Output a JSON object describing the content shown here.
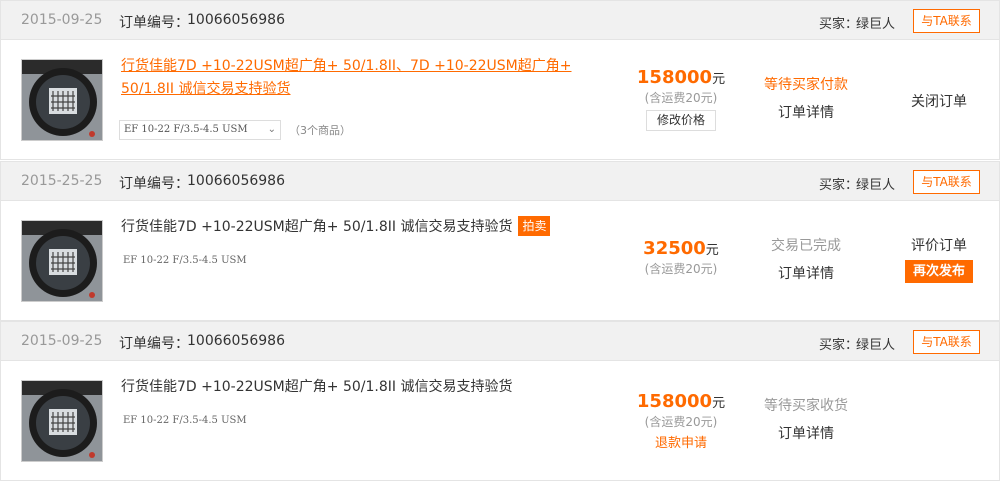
{
  "orders": [
    {
      "date": "2015-09-25",
      "order_no_label": "订单编号：",
      "order_no": "10066056986",
      "buyer_label": "买家：",
      "buyer_name": "绿巨人",
      "contact_label": "与TA联系",
      "title": "行货佳能7D +10-22USM超广角+ 50/1.8II、7D +10-22USM超广角+ 50/1.8II 诚信交易支持验货",
      "spec_select": "EF 10-22 F/3.5-4.5 USM",
      "item_count": "（3个商品）",
      "price": "158000",
      "price_unit": "元",
      "shipping": "(含运费20元)",
      "modify_price_label": "修改价格",
      "status": "等待买家付款",
      "detail_label": "订单详情",
      "action_label": "关闭订单"
    },
    {
      "date": "2015-25-25",
      "order_no_label": "订单编号：",
      "order_no": "10066056986",
      "buyer_label": "买家：",
      "buyer_name": "绿巨人",
      "contact_label": "与TA联系",
      "title": "行货佳能7D +10-22USM超广角+ 50/1.8II 诚信交易支持验货",
      "tag": "拍卖",
      "spec": "EF 10-22 F/3.5-4.5 USM",
      "price": "32500",
      "price_unit": "元",
      "shipping": "(含运费20元)",
      "status": "交易已完成",
      "detail_label": "订单详情",
      "action_label": "评价订单",
      "republish_label": "再次发布"
    },
    {
      "date": "2015-09-25",
      "order_no_label": "订单编号：",
      "order_no": "10066056986",
      "buyer_label": "买家：",
      "buyer_name": "绿巨人",
      "contact_label": "与TA联系",
      "title": "行货佳能7D +10-22USM超广角+ 50/1.8II 诚信交易支持验货",
      "spec": "EF 10-22 F/3.5-4.5 USM",
      "price": "158000",
      "price_unit": "元",
      "shipping": "(含运费20元)",
      "refund_label": "退款申请",
      "status": "等待买家收货",
      "detail_label": "订单详情"
    }
  ],
  "icons": {
    "select_chevron": "chevron-down-icon",
    "product_image": "camera-lens-image"
  },
  "colors": {
    "accent": "#ff6a00",
    "header_bg": "#f1f1f1",
    "muted": "#999999"
  }
}
